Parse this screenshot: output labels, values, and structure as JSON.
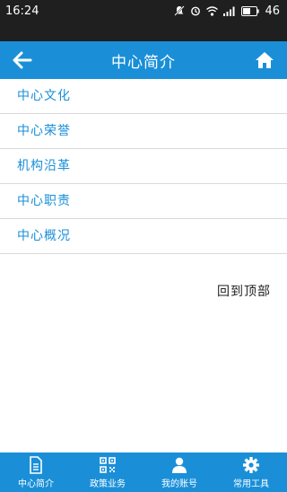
{
  "status_bar": {
    "time": "16:24",
    "battery": "46"
  },
  "header": {
    "title": "中心简介",
    "back_icon": "arrow-left-icon",
    "home_icon": "home-icon"
  },
  "menu": {
    "items": [
      {
        "label": "中心文化"
      },
      {
        "label": "中心荣誉"
      },
      {
        "label": "机构沿革"
      },
      {
        "label": "中心职责"
      },
      {
        "label": "中心概况"
      }
    ]
  },
  "back_to_top": "回到顶部",
  "tabbar": {
    "tabs": [
      {
        "label": "中心简介",
        "icon": "document-icon"
      },
      {
        "label": "政策业务",
        "icon": "qrcode-icon"
      },
      {
        "label": "我的账号",
        "icon": "user-icon"
      },
      {
        "label": "常用工具",
        "icon": "gear-icon"
      }
    ]
  },
  "colors": {
    "accent": "#1a8fd8",
    "status_bar": "#1f1f1f"
  }
}
